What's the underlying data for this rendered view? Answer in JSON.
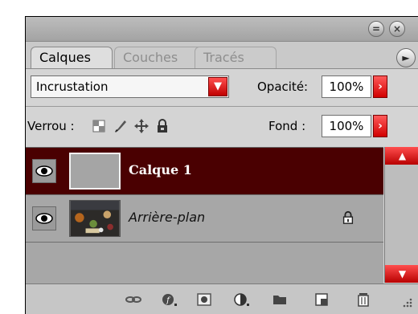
{
  "tabs": {
    "active": "Calques",
    "couches": "Couches",
    "traces": "Tracés"
  },
  "blend": {
    "mode": "Incrustation",
    "opacity_label": "Opacité:",
    "opacity_value": "100%"
  },
  "lock": {
    "label": "Verrou :",
    "fill_label": "Fond :",
    "fill_value": "100%"
  },
  "layers": [
    {
      "name": "Calque 1",
      "selected": true
    },
    {
      "name": "Arrière-plan",
      "selected": false
    }
  ],
  "colors": {
    "accent_red": "#d10000",
    "selected_layer_bg": "#4a0001",
    "panel_bg": "#d4d4d4",
    "layer_list_bg": "#a7a7a7"
  },
  "icons": {
    "titlebar": [
      "minimize-icon",
      "close-icon"
    ],
    "lock": [
      "lock-transparency-icon",
      "lock-paint-icon",
      "lock-move-icon",
      "lock-all-icon"
    ],
    "bottom": [
      "link-layers-icon",
      "layer-style-icon",
      "layer-mask-icon",
      "adjustment-layer-icon",
      "new-group-icon",
      "new-layer-icon",
      "delete-layer-icon"
    ]
  }
}
